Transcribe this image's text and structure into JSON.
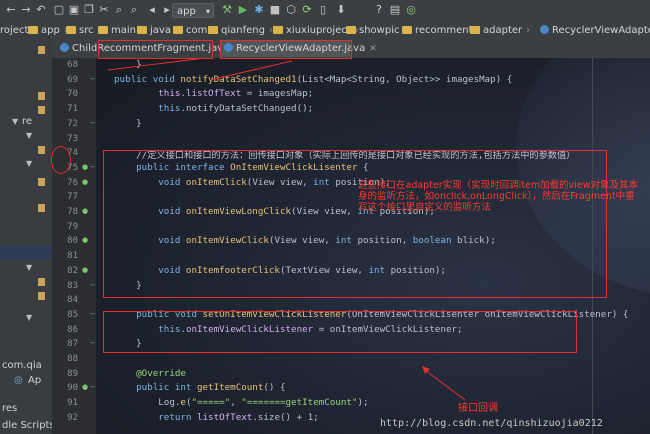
{
  "toolbar": {
    "run_config": "app",
    "icons": [
      "back-icon",
      "forward-icon",
      "undo-icon",
      "open-icon",
      "save-icon",
      "copy-icon",
      "cut-icon",
      "search-icon",
      "find-replace-icon",
      "back-arrow-icon",
      "forward-arrow-icon",
      "build-icon",
      "run-icon",
      "debug-icon",
      "stop-icon",
      "attach-icon",
      "sync-icon",
      "avd-icon",
      "sdk-icon",
      "help-icon",
      "structure-icon",
      "android-icon"
    ]
  },
  "breadcrumb": [
    "roject",
    "app",
    "src",
    "main",
    "java",
    "com",
    "qianfeng",
    "xiuxiuproject",
    "showpic",
    "recomment",
    "adapter",
    "RecyclerViewAdapter"
  ],
  "tabs": [
    {
      "label": "ChildRecommentFragment.java",
      "active": false
    },
    {
      "label": "RecyclerViewAdapter.java",
      "active": true
    }
  ],
  "sidebar": {
    "labels": [
      "re",
      "com.qia",
      "Ap",
      "res",
      "dle Scripts"
    ]
  },
  "code_lines": [
    {
      "n": "68",
      "parts": [
        [
          "",
          "    }"
        ]
      ]
    },
    {
      "n": "69",
      "parts": [
        [
          "kw",
          "public void "
        ],
        [
          "fn",
          "notifyDataSetChanged1"
        ],
        [
          "",
          "(List<Map<String, Object>> imagesMap) {"
        ]
      ]
    },
    {
      "n": "70",
      "parts": [
        [
          "",
          "        "
        ],
        [
          "fld",
          "this.listOfText"
        ],
        [
          "",
          " = imagesMap;"
        ]
      ]
    },
    {
      "n": "71",
      "parts": [
        [
          "",
          "        "
        ],
        [
          "kw",
          "this"
        ],
        [
          "",
          ".notifyDataSetChanged();"
        ]
      ]
    },
    {
      "n": "72",
      "parts": [
        [
          "",
          "    }"
        ]
      ]
    },
    {
      "n": "73",
      "parts": [
        [
          "",
          ""
        ]
      ]
    },
    {
      "n": "74",
      "parts": [
        [
          "cmt",
          "    //定义接口和接口的方法：回传接口对象（实际上回传的是接口对象已经实现的方法,包括方法中的参数值）"
        ]
      ]
    },
    {
      "n": "75",
      "parts": [
        [
          "kw",
          "    public interface "
        ],
        [
          "fn",
          "OnItemViewClickLisenter"
        ],
        [
          "",
          " {"
        ]
      ]
    },
    {
      "n": "76",
      "parts": [
        [
          "kw",
          "        void "
        ],
        [
          "fn",
          "onItemClick"
        ],
        [
          "",
          "(View view, "
        ],
        [
          "kw",
          "int"
        ],
        [
          "",
          " position);"
        ]
      ]
    },
    {
      "n": "77",
      "parts": [
        [
          "",
          ""
        ]
      ]
    },
    {
      "n": "78",
      "parts": [
        [
          "kw",
          "        void "
        ],
        [
          "fn",
          "onItemViewLongClick"
        ],
        [
          "",
          "(View view, "
        ],
        [
          "kw",
          "int"
        ],
        [
          "",
          " position);"
        ]
      ]
    },
    {
      "n": "79",
      "parts": [
        [
          "",
          ""
        ]
      ]
    },
    {
      "n": "80",
      "parts": [
        [
          "kw",
          "        void "
        ],
        [
          "fn",
          "onItemViewClick"
        ],
        [
          "",
          "(View view, "
        ],
        [
          "kw",
          "int"
        ],
        [
          "",
          " position, "
        ],
        [
          "kw",
          "boolean"
        ],
        [
          "",
          " blick);"
        ]
      ]
    },
    {
      "n": "81",
      "parts": [
        [
          "",
          ""
        ]
      ]
    },
    {
      "n": "82",
      "parts": [
        [
          "kw",
          "        void "
        ],
        [
          "fn",
          "onItemfooterClick"
        ],
        [
          "",
          "(TextView view, "
        ],
        [
          "kw",
          "int"
        ],
        [
          "",
          " position);"
        ]
      ]
    },
    {
      "n": "83",
      "parts": [
        [
          "",
          "    }"
        ]
      ]
    },
    {
      "n": "84",
      "parts": [
        [
          "",
          ""
        ]
      ]
    },
    {
      "n": "85",
      "parts": [
        [
          "kw",
          "    public void "
        ],
        [
          "fn",
          "setOnItemViewClickListener"
        ],
        [
          "",
          "(OnItemViewClickLisenter onItemViewClickListener) {"
        ]
      ]
    },
    {
      "n": "86",
      "parts": [
        [
          "",
          "        "
        ],
        [
          "kw",
          "this"
        ],
        [
          "",
          "."
        ],
        [
          "fld",
          "onItemViewClickListener"
        ],
        [
          "",
          " = onItemViewClickListener;"
        ]
      ]
    },
    {
      "n": "87",
      "parts": [
        [
          "",
          "    }"
        ]
      ]
    },
    {
      "n": "88",
      "parts": [
        [
          "",
          ""
        ]
      ]
    },
    {
      "n": "89",
      "parts": [
        [
          "str",
          "    @Override"
        ]
      ]
    },
    {
      "n": "90",
      "parts": [
        [
          "kw",
          "    public int "
        ],
        [
          "fn",
          "getItemCount"
        ],
        [
          "",
          "() {"
        ]
      ]
    },
    {
      "n": "91",
      "parts": [
        [
          "",
          "        Log."
        ],
        [
          "fn",
          "e"
        ],
        [
          "",
          "("
        ],
        [
          "str",
          "\"=====\""
        ],
        [
          ",",
          ", "
        ],
        [
          "str",
          "\"=======getItemCount\""
        ],
        [
          "",
          ");"
        ]
      ]
    },
    {
      "n": "92",
      "parts": [
        [
          "kw",
          "        return "
        ],
        [
          "fld",
          "listOfText"
        ],
        [
          "",
          ".size() + 1;"
        ]
      ]
    }
  ],
  "annotations": {
    "interface_note": [
      "这些接口在adapter实现（实现时回调item加载的view对象及其本",
      "身的监听方法，如onclick,onLongClick），然后在Fragment中重",
      "写这个接口里自定义的监听方法"
    ],
    "callback_note": "接口回调"
  },
  "watermark": "http://blog.csdn.net/qinshizuojia0212"
}
